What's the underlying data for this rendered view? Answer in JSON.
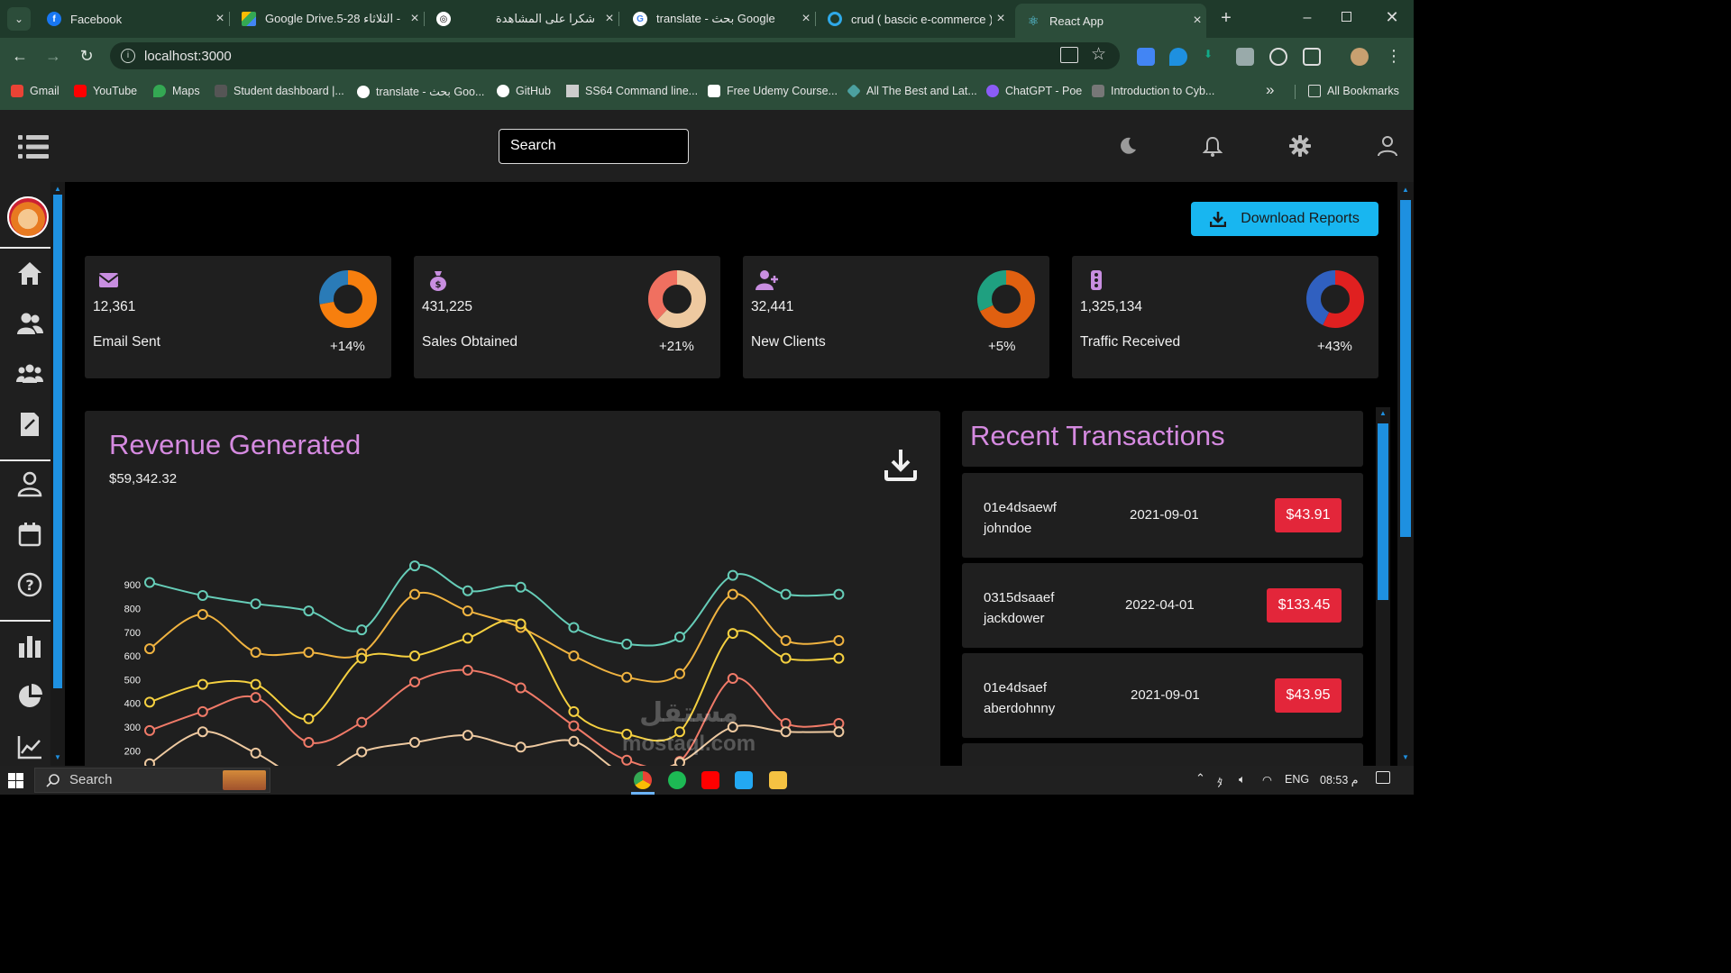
{
  "browser": {
    "tabs": [
      {
        "title": "Facebook",
        "active": false
      },
      {
        "title": "Google Drive.5-28 الثلاثاء -",
        "active": false
      },
      {
        "title": "شكرا على المشاهدة",
        "active": false
      },
      {
        "title": "translate - بحث Google",
        "active": false
      },
      {
        "title": "crud ( bascic e-commerce )",
        "active": false
      },
      {
        "title": "React App",
        "active": true
      }
    ],
    "url": "localhost:3000",
    "bookmarks": [
      {
        "label": "Gmail",
        "color": "#ea4335"
      },
      {
        "label": "YouTube",
        "color": "#ff0000"
      },
      {
        "label": "Maps",
        "color": "#34a853"
      },
      {
        "label": "Student dashboard |...",
        "color": "#555555"
      },
      {
        "label": "translate - بحث Goo...",
        "color": "#4285f4"
      },
      {
        "label": "GitHub",
        "color": "#ffffff"
      },
      {
        "label": "SS64 Command line...",
        "color": "#cccccc"
      },
      {
        "label": "Free Udemy Course...",
        "color": "#e04040"
      },
      {
        "label": "All The Best and Lat...",
        "color": "#4ca0a0"
      },
      {
        "label": "ChatGPT - Poe",
        "color": "#8b5cf6"
      },
      {
        "label": "Introduction to Cyb...",
        "color": "#777777"
      }
    ],
    "all_bookmarks": "All Bookmarks"
  },
  "app": {
    "search_placeholder": "Search",
    "download_reports": "Download Reports",
    "stats": [
      {
        "icon": "email-icon",
        "value": "12,361",
        "label": "Email Sent",
        "percent": "+14%",
        "donut": [
          0.72,
          0.28
        ],
        "colors": [
          "#f77f0e",
          "#2a7bb7"
        ]
      },
      {
        "icon": "money-bag-icon",
        "value": "431,225",
        "label": "Sales Obtained",
        "percent": "+21%",
        "donut": [
          0.62,
          0.38
        ],
        "colors": [
          "#eec9a0",
          "#f07060"
        ]
      },
      {
        "icon": "add-user-icon",
        "value": "32,441",
        "label": "New Clients",
        "percent": "+5%",
        "donut": [
          0.68,
          0.32
        ],
        "colors": [
          "#e06010",
          "#1fa080"
        ]
      },
      {
        "icon": "traffic-icon",
        "value": "1,325,134",
        "label": "Traffic Received",
        "percent": "+43%",
        "donut": [
          0.57,
          0.43
        ],
        "colors": [
          "#e02020",
          "#3060c0"
        ]
      }
    ],
    "revenue": {
      "title": "Revenue Generated",
      "amount": "$59,342.32"
    },
    "transactions": {
      "title": "Recent Transactions",
      "items": [
        {
          "txId": "01e4dsaewf",
          "user": "johndoe",
          "date": "2021-09-01",
          "cost": "$43.91"
        },
        {
          "txId": "0315dsaaef",
          "user": "jackdower",
          "date": "2022-04-01",
          "cost": "$133.45"
        },
        {
          "txId": "01e4dsaef",
          "user": "aberdohnny",
          "date": "2021-09-01",
          "cost": "$43.95"
        }
      ]
    }
  },
  "chart_data": {
    "type": "line",
    "yticks": [
      "900",
      "800",
      "700",
      "600",
      "500",
      "400",
      "300",
      "200"
    ],
    "ylim": [
      150,
      950
    ],
    "x": [
      0,
      1,
      2,
      3,
      4,
      5,
      6,
      7,
      8,
      9,
      10,
      11,
      12,
      13
    ],
    "series": [
      {
        "color": "#66cdb8",
        "values": [
          910,
          855,
          820,
          790,
          710,
          980,
          875,
          890,
          720,
          650,
          680,
          940,
          860,
          860
        ]
      },
      {
        "color": "#f0b340",
        "values": [
          630,
          775,
          615,
          615,
          610,
          860,
          790,
          720,
          600,
          510,
          525,
          860,
          665,
          665
        ]
      },
      {
        "color": "#f5d040",
        "values": [
          405,
          480,
          480,
          335,
          590,
          600,
          675,
          735,
          365,
          270,
          280,
          695,
          590,
          590
        ]
      },
      {
        "color": "#f07a68",
        "values": [
          285,
          365,
          425,
          235,
          320,
          490,
          540,
          465,
          305,
          160,
          155,
          505,
          315,
          315
        ]
      },
      {
        "color": "#eec9a0",
        "values": [
          145,
          280,
          190,
          80,
          195,
          235,
          265,
          215,
          240,
          100,
          150,
          300,
          280,
          280
        ]
      }
    ]
  },
  "taskbar": {
    "search": "Search",
    "lang": "ENG",
    "time": "08:53 م"
  },
  "watermark": {
    "line1": "مستقل",
    "line2": "mostaql.com"
  }
}
